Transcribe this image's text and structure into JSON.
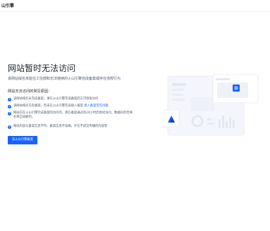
{
  "header": {
    "logo_text": "山引擎"
  },
  "main": {
    "title": "网站暂时无法访问",
    "subtitle": "该网站域名未能在工信部和无法继续的火山引擎完成备案或存在违规行为",
    "reasons_heading": "网站无法访问的常见原因：",
    "reasons": [
      {
        "number": "1",
        "text": "该网站域名未完成备案，请在火山引擎完成备案后方可恢复访问"
      },
      {
        "number": "2",
        "text": "该网站域名已有备案，但未在火山引擎完成接入备案",
        "link": "接入备案常见问题"
      },
      {
        "number": "3",
        "text": "网站已在火山引擎完成备案的访问的，请在备案通过的24小时后尝试访问，数据同步后域名将自动解封。"
      },
      {
        "number": "4",
        "text": "网站内容与备案信息不符、备案信息不准确，存在不适宜传播的内容等"
      }
    ],
    "cta_label": "去火山引擎备案"
  },
  "colors": {
    "accent": "#1664ff",
    "title": "#1d2129",
    "body": "#4e5969"
  }
}
